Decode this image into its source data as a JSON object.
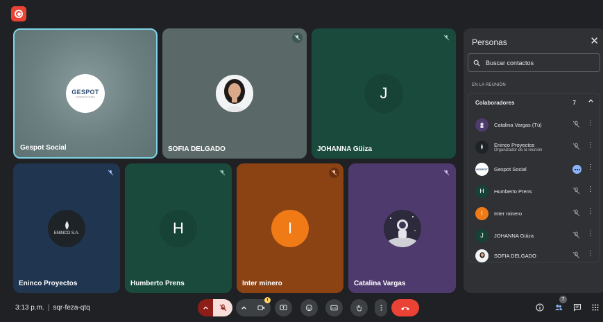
{
  "meeting": {
    "time": "3:13 p.m.",
    "code": "sqr-feza-qtq",
    "badge_count": "7"
  },
  "tiles": {
    "gespot": {
      "name": "Gespot Social",
      "logo_text": "GESPOT",
      "logo_sub": "COMUNICACIONES"
    },
    "sofia": {
      "name": "SOFIA DELGADO"
    },
    "johanna": {
      "name": "JOHANNA Güiza",
      "letter": "J"
    },
    "eninco": {
      "name": "Eninco Proyectos",
      "logo_text": "ENINCO S.A."
    },
    "humberto": {
      "name": "Humberto Prens",
      "letter": "H"
    },
    "inter": {
      "name": "Inter minero",
      "letter": "I"
    },
    "catalina": {
      "name": "Catalina Vargas"
    }
  },
  "panel": {
    "title": "Personas",
    "search_placeholder": "Buscar contactos",
    "section": "EN LA REUNIÓN",
    "group_title": "Colaboradores",
    "group_count": "7",
    "people": [
      {
        "name": "Catalina Vargas (Tú)",
        "sub": ""
      },
      {
        "name": "Eninco Proyectos",
        "sub": "Organizador de la reunión"
      },
      {
        "name": "Gespot Social",
        "sub": ""
      },
      {
        "name": "Humberto Prens",
        "sub": "",
        "letter": "H"
      },
      {
        "name": "Inter minero",
        "sub": "",
        "letter": "I"
      },
      {
        "name": "JOHANNA Güiza",
        "sub": "",
        "letter": "J"
      },
      {
        "name": "SOFIA DELGADO",
        "sub": ""
      }
    ]
  },
  "colors": {
    "end_call": "#ea4335",
    "mic_off": "#f28b82",
    "accent": "#8ab4f8",
    "speaking_border": "#7fd3e6"
  },
  "icons": [
    "record-icon",
    "mic-off-icon",
    "camera-icon",
    "present-icon",
    "emoji-icon",
    "captions-icon",
    "hand-icon",
    "more-icon",
    "end-call-icon",
    "info-icon",
    "people-icon",
    "chat-icon",
    "apps-icon",
    "search-icon",
    "close-icon",
    "chevron-up-icon"
  ]
}
